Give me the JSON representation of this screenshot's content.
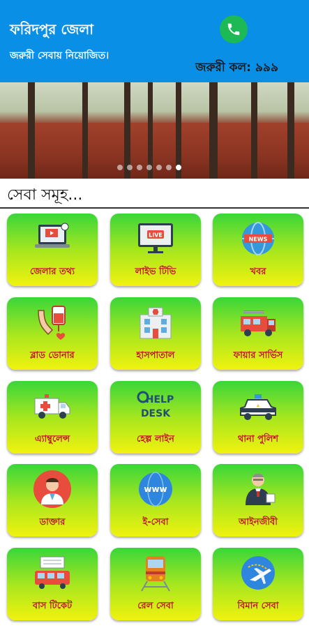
{
  "header": {
    "title": "ফরিদপুর জেলা",
    "subtitle": "জরুরী সেবায় নিয়োজিত।",
    "emergency_call": "জরুরী কল: ৯৯৯"
  },
  "banner": {
    "slide_count": 7,
    "active_slide": 6
  },
  "section": {
    "title": "সেবা সমূহ..."
  },
  "services": [
    {
      "label": "জেলার তথ্য",
      "icon": "info-laptop-icon"
    },
    {
      "label": "লাইভ টিভি",
      "icon": "live-tv-icon"
    },
    {
      "label": "খবর",
      "icon": "news-globe-icon"
    },
    {
      "label": "ব্লাড ডোনার",
      "icon": "blood-donation-icon"
    },
    {
      "label": "হাসপাতাল",
      "icon": "hospital-icon"
    },
    {
      "label": "ফায়ার সার্ভিস",
      "icon": "fire-truck-icon"
    },
    {
      "label": "এ্যাম্বুলেন্স",
      "icon": "ambulance-icon"
    },
    {
      "label": "হেল্প লাইন",
      "icon": "help-desk-icon"
    },
    {
      "label": "থানা পুলিশ",
      "icon": "police-car-icon"
    },
    {
      "label": "ডাক্তার",
      "icon": "doctor-icon"
    },
    {
      "label": "ই-সেবা",
      "icon": "www-globe-icon"
    },
    {
      "label": "আইনজীবী",
      "icon": "lawyer-icon"
    },
    {
      "label": "বাস টিকেট",
      "icon": "bus-icon"
    },
    {
      "label": "রেল সেবা",
      "icon": "train-icon"
    },
    {
      "label": "বিমান সেবা",
      "icon": "airplane-icon"
    }
  ],
  "help_desk_text": "HELP DESK",
  "live_text": "LIVE",
  "news_text": "NEWS",
  "www_text": "www"
}
